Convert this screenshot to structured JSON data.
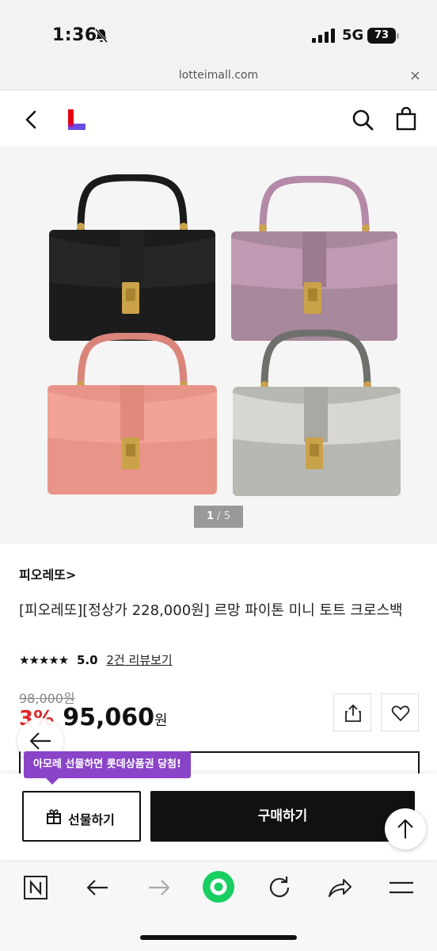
{
  "status_bar": {
    "time": "1:36",
    "network": "5G",
    "battery": "73"
  },
  "url_bar": {
    "url": "lotteimall.com",
    "close": "×"
  },
  "gallery": {
    "page_current": "1",
    "page_sep": " / ",
    "page_total": "5"
  },
  "product": {
    "brand": "피오레또",
    "brand_chevron": ">",
    "name": "[피오레또][정상가 228,000원] 르망 파이톤 미니 토트 크로스백",
    "stars": "★★★★★",
    "rating": "5.0",
    "review_link": "2건 리뷰보기",
    "original_price": "98,000원",
    "discount": "3%",
    "price": "95,060",
    "price_unit": "원"
  },
  "actions": {
    "promo": "아모레 선물하면 롯데상품권 당첨!",
    "gift_label": "선물하기",
    "buy_label": "구매하기"
  },
  "colors": {
    "accent_red": "#e0262a",
    "promo_purple": "#8a44c8",
    "logo_red": "#e60012",
    "logo_purple": "#6b4de6"
  }
}
